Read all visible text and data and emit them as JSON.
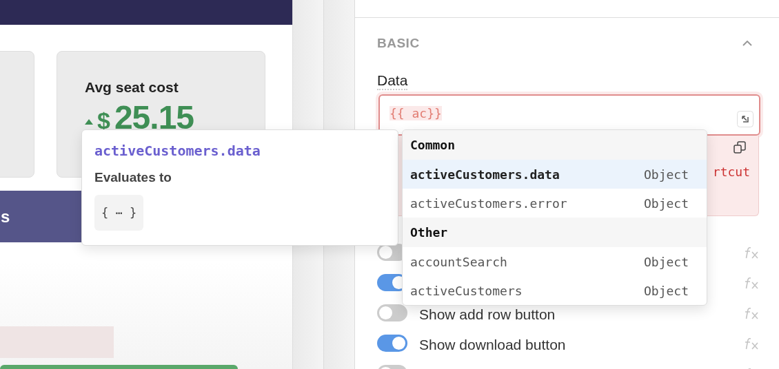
{
  "canvas": {
    "header": {
      "kind": "bar"
    },
    "stat_card": {
      "label": "Avg seat cost",
      "currency": "$",
      "amount": "25.15"
    },
    "banner": {
      "text": "s"
    }
  },
  "inspector": {
    "section": {
      "title": "BASIC",
      "expanded": true
    },
    "field": {
      "label": "Data",
      "value": "{{ ac}}",
      "error": true
    },
    "error_text": "rtcut",
    "toggles": [
      {
        "on": false
      },
      {
        "on": true
      },
      {
        "label": "Show add row button",
        "on": false
      },
      {
        "label": "Show download button",
        "on": true
      },
      {
        "on": false
      }
    ]
  },
  "tooltip": {
    "title": "activeCustomers.data",
    "subtitle": "Evaluates to",
    "value": "{ ⋯ }"
  },
  "autocomplete": {
    "groups": [
      {
        "title": "Common",
        "items": [
          {
            "name": "activeCustomers.data",
            "type": "Object",
            "selected": true
          },
          {
            "name": "activeCustomers.error",
            "type": "Object",
            "selected": false
          }
        ]
      },
      {
        "title": "Other",
        "items": [
          {
            "name": "accountSearch",
            "type": "Object",
            "selected": false
          },
          {
            "name": "activeCustomers",
            "type": "Object",
            "selected": false
          }
        ]
      }
    ]
  }
}
